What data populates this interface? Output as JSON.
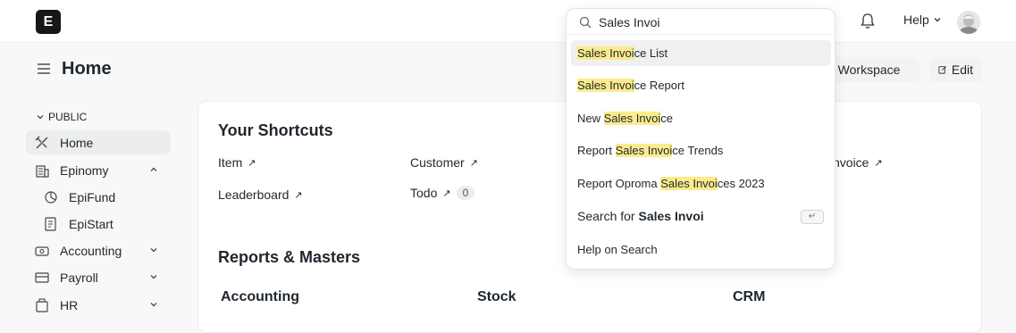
{
  "topbar": {
    "logo_letter": "E",
    "help_label": "Help"
  },
  "page": {
    "title": "Home",
    "workspace_button": "e Workspace",
    "edit_button": "Edit"
  },
  "sidebar": {
    "section_label": "PUBLIC",
    "items": [
      {
        "label": "Home"
      },
      {
        "label": "Epinomy"
      },
      {
        "label": "EpiFund"
      },
      {
        "label": "EpiStart"
      },
      {
        "label": "Accounting"
      },
      {
        "label": "Payroll"
      },
      {
        "label": "HR"
      }
    ]
  },
  "shortcuts": {
    "title": "Your Shortcuts",
    "items": [
      {
        "label": "Item"
      },
      {
        "label": "Customer"
      },
      {
        "label": "nvoice"
      },
      {
        "label": "Leaderboard"
      },
      {
        "label": "Todo",
        "count": "0"
      }
    ]
  },
  "reports": {
    "title": "Reports & Masters",
    "columns": [
      "Accounting",
      "Stock",
      "CRM"
    ]
  },
  "search": {
    "query": "Sales Invoi",
    "results": [
      {
        "match": "Sales Invoi",
        "post": "ce List"
      },
      {
        "match": "Sales Invoi",
        "post": "ce Report"
      },
      {
        "pre": "New ",
        "match": "Sales Invoi",
        "post": "ce"
      },
      {
        "pre": "Report ",
        "match": "Sales Invoi",
        "post": "ce Trends"
      },
      {
        "pre": "Report Oproma ",
        "match": "Sales Invoi",
        "post": "ces 2023"
      }
    ],
    "search_for_prefix": "Search for ",
    "search_for_query": "Sales Invoi",
    "enter_key": "↵",
    "help_on_search": "Help on Search"
  },
  "colors": {
    "highlight": "#fbeb8c",
    "active_bg": "#eceded"
  },
  "icons": [
    "search-icon",
    "bell-icon",
    "chevron-down-icon",
    "menu-icon",
    "edit-icon",
    "home-icon",
    "building-icon",
    "fund-icon",
    "file-icon",
    "accounting-icon",
    "payroll-icon",
    "hr-icon",
    "arrow-up-right-icon",
    "enter-key-icon"
  ]
}
